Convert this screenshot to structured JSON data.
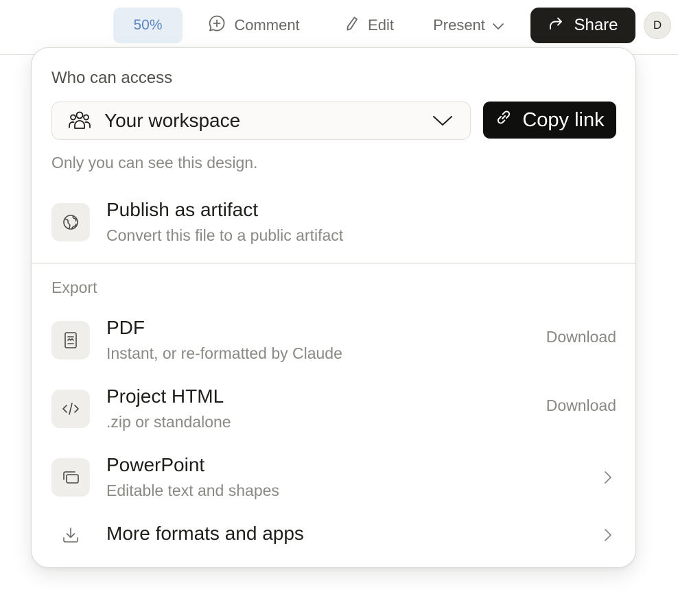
{
  "toolbar": {
    "zoom": "50%",
    "comment_label": "Comment",
    "edit_label": "Edit",
    "present_label": "Present",
    "share_label": "Share",
    "avatar_initial": "D"
  },
  "share_panel": {
    "access_heading": "Who can access",
    "access_select": {
      "selected": "Your workspace",
      "icon": "users-icon"
    },
    "copy_link_label": "Copy link",
    "visibility_note": "Only you can see this design.",
    "publish": {
      "title": "Publish as artifact",
      "subtitle": "Convert this file to a public artifact",
      "icon": "globe-icon"
    },
    "export_heading": "Export",
    "export_items": [
      {
        "title": "PDF",
        "subtitle": "Instant, or re-formatted by Claude",
        "action": "Download",
        "icon": "document-icon"
      },
      {
        "title": "Project HTML",
        "subtitle": ".zip or standalone",
        "action": "Download",
        "icon": "code-icon"
      },
      {
        "title": "PowerPoint",
        "subtitle": "Editable text and shapes",
        "icon": "slides-icon"
      }
    ],
    "more_formats": {
      "title": "More formats and apps",
      "icon": "download-icon"
    }
  },
  "colors": {
    "primary_button": "#1f1e1b",
    "zoom_bg": "#e7eef6",
    "zoom_text": "#5a86bf",
    "muted_text": "#8b8984"
  }
}
